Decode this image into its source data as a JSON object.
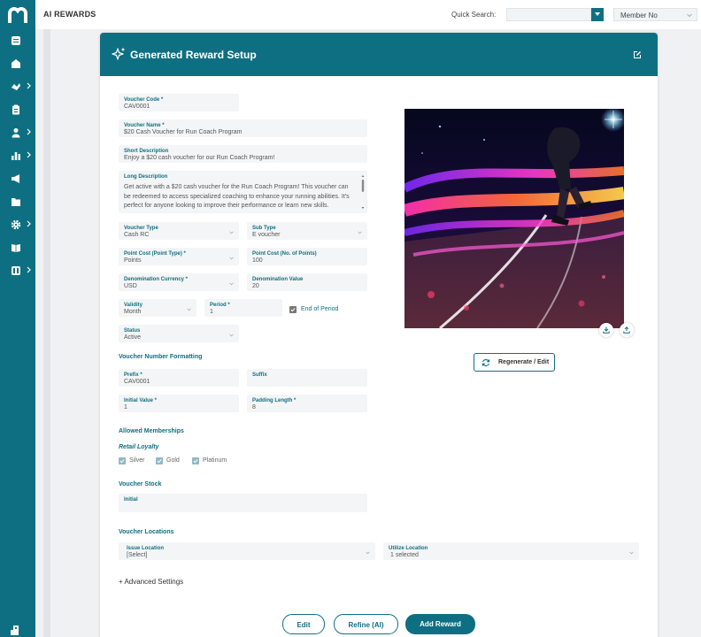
{
  "app": {
    "title": "AI REWARDS"
  },
  "topbar": {
    "quick_search_label": "Quick Search:",
    "quick_search_value": "",
    "member_select": "Member No"
  },
  "colors": {
    "brand": "#0f6f82",
    "field_bg": "#f4f5f6",
    "checkbox_on": "#8fb9c3"
  },
  "card": {
    "title": "Generated Reward Setup"
  },
  "form": {
    "voucher_code": {
      "label": "Voucher Code *",
      "value": "CAV0001"
    },
    "voucher_name": {
      "label": "Voucher Name *",
      "value": "$20 Cash Voucher for Run Coach Program"
    },
    "short_description": {
      "label": "Short Description",
      "value": "Enjoy a $20 cash voucher for our Run Coach Program!"
    },
    "long_description": {
      "label": "Long Description",
      "value": "Get active with a $20 cash voucher for the Run Coach Program! This voucher can be redeemed to access specialized coaching to enhance your running abilities. It's perfect for anyone looking to improve their performance or learn new skills."
    },
    "voucher_type": {
      "label": "Voucher Type",
      "value": "Cash RC"
    },
    "sub_type": {
      "label": "Sub Type",
      "value": "E voucher"
    },
    "point_cost_type": {
      "label": "Point Cost (Point Type) *",
      "value": "Points"
    },
    "point_cost_points": {
      "label": "Point Cost (No. of Points)",
      "value": "100"
    },
    "denomination_currency": {
      "label": "Denomination Currency *",
      "value": "USD"
    },
    "denomination_value": {
      "label": "Denomination Value",
      "value": "20"
    },
    "validity": {
      "label": "Validity",
      "value": "Month"
    },
    "period": {
      "label": "Period *",
      "value": "1"
    },
    "end_of_period": {
      "label": "End of Period",
      "checked": true
    },
    "status": {
      "label": "Status",
      "value": "Active"
    }
  },
  "voucher_number_formatting": {
    "title": "Voucher Number Formatting",
    "prefix": {
      "label": "Prefix *",
      "value": "CAV0001"
    },
    "suffix": {
      "label": "Suffix",
      "value": ""
    },
    "initial_value": {
      "label": "Initial Value *",
      "value": "1"
    },
    "padding_length": {
      "label": "Padding Length *",
      "value": "8"
    }
  },
  "memberships": {
    "title": "Allowed Memberships",
    "group": "Retail Loyalty",
    "tiers": [
      {
        "label": "Silver",
        "checked": true
      },
      {
        "label": "Gold",
        "checked": true
      },
      {
        "label": "Platinum",
        "checked": true
      }
    ]
  },
  "stock": {
    "title": "Voucher Stock",
    "initial": {
      "label": "Initial",
      "value": ""
    }
  },
  "locations": {
    "title": "Voucher Locations",
    "issue": {
      "label": "Issue Location",
      "value": "[Select]"
    },
    "utilize": {
      "label": "Utilize Location",
      "value": "1 selected"
    }
  },
  "image": {
    "regenerate_label": "Regenerate / Edit"
  },
  "advanced": "+ Advanced Settings",
  "buttons": {
    "edit": "Edit",
    "refine": "Refine (AI)",
    "add": "Add Reward"
  }
}
